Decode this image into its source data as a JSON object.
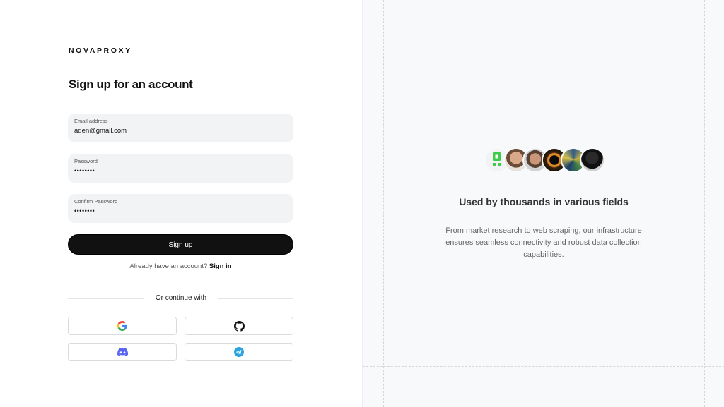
{
  "brand": {
    "name": "NOVAPROXY"
  },
  "form": {
    "title": "Sign up for an account",
    "email": {
      "label": "Email address",
      "value": "aden@gmail.com"
    },
    "password": {
      "label": "Password",
      "value": "••••••••"
    },
    "confirm": {
      "label": "Confirm Password",
      "value": "••••••••"
    },
    "submit_label": "Sign up",
    "have_account_text": "Already have an account?",
    "signin_link": "Sign in",
    "or_continue": "Or continue with"
  },
  "social": {
    "providers": [
      "google-icon",
      "github-icon",
      "discord-icon",
      "telegram-icon"
    ]
  },
  "showcase": {
    "heading": "Used by thousands in various fields",
    "description": "From market research to web scraping, our infrastructure ensures seamless connectivity and robust data collection capabilities."
  },
  "colors": {
    "primary_button": "#111111",
    "discord": "#5865F2",
    "telegram": "#2AA3DF",
    "logo_green": "#3DCB4C"
  }
}
